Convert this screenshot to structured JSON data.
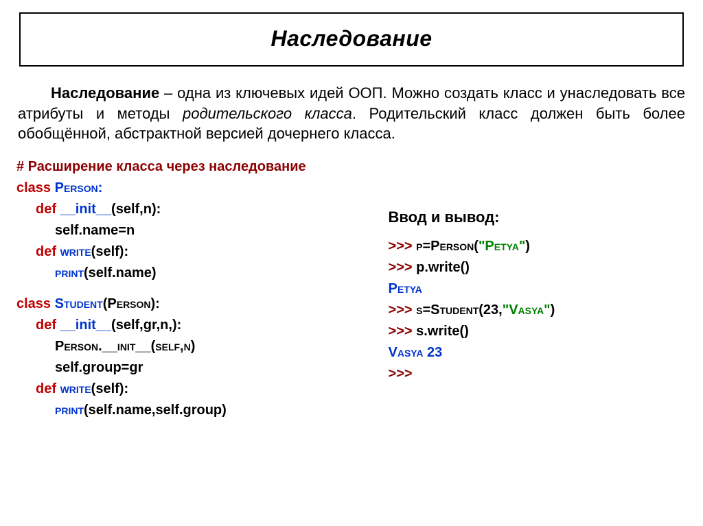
{
  "title": "Наследование",
  "paragraph": {
    "term": "Наследование",
    "rest1": " – одна из ключевых идей ООП. Можно создать класс и унаследовать все атрибуты и методы ",
    "parent": "родительского класса",
    "rest2": ". Родительский класс должен быть более обобщённой, абстрактной версией дочернего класса."
  },
  "code": {
    "comment": "# Расширение класса через наследование",
    "l1_kw": "class ",
    "l1_name": "Person",
    "l1_colon": ":",
    "l2_def": "def ",
    "l2_fn": "__init__",
    "l2_args": "(self,n):",
    "l3": "self.name=n",
    "l4_def": "def ",
    "l4_fn": "write",
    "l4_args": "(self):",
    "l5_print": "print",
    "l5_args": "(self.name)",
    "l6_kw": "class ",
    "l6_name": "Student",
    "l6_args": "(Person):",
    "l7_def": "def ",
    "l7_fn": "__init__",
    "l7_args": "(self,gr,n,):",
    "l8": "Person.__init__(self,n)",
    "l9": "self.group=gr",
    "l10_def": "def ",
    "l10_fn": "write",
    "l10_args": "(self):",
    "l11_print": "print",
    "l11_args": "(self.name,self.group)"
  },
  "io": {
    "heading": "Ввод и вывод:",
    "p1": ">>> ",
    "l1a": "p=Person(",
    "l1b": "\"Petya\"",
    "l1c": ")",
    "l2": "p.write()",
    "out1": "Petya",
    "l3a": "s=Student(23,",
    "l3b": "\"Vasya\"",
    "l3c": ")",
    "l4": "s.write()",
    "out2": "Vasya 23",
    "last": ">>>"
  }
}
